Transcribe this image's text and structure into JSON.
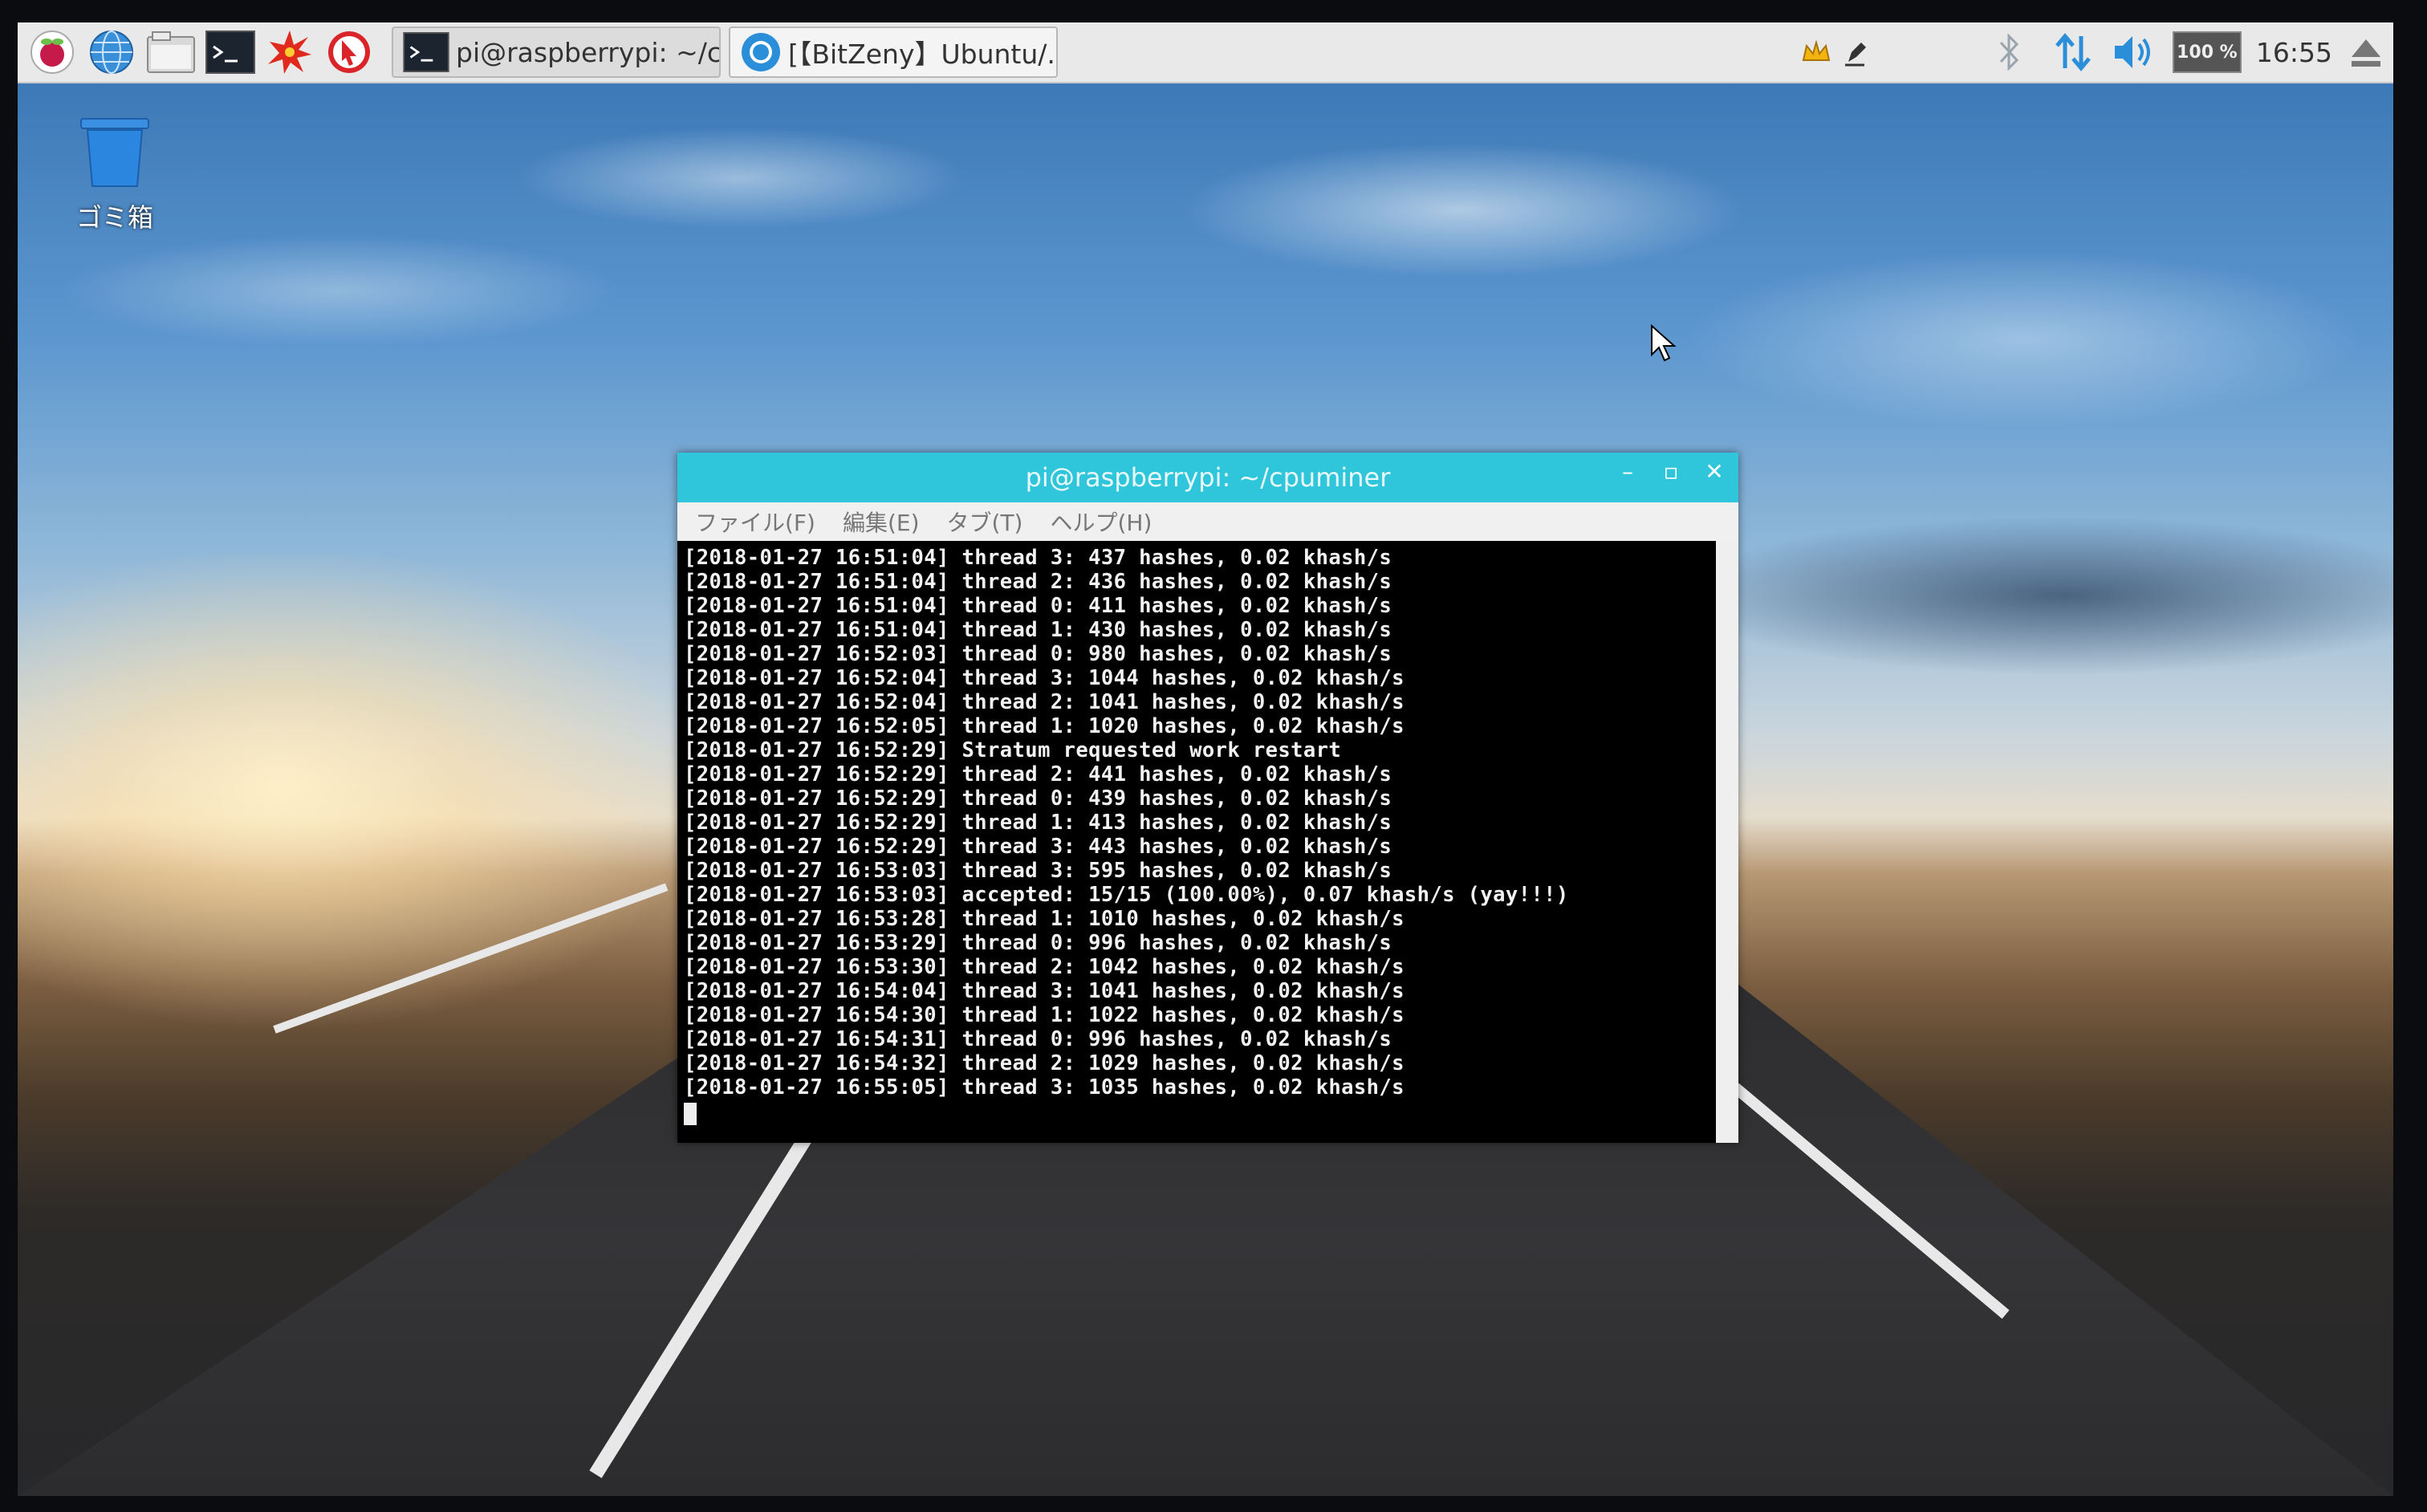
{
  "taskbar": {
    "launchers": [
      "raspberry-menu-icon",
      "globe-icon",
      "folder-icon",
      "terminal-icon",
      "burst-icon",
      "pointer-app-icon"
    ],
    "tasks": [
      {
        "label": "pi@raspberrypi: ~/cp...",
        "icon": "terminal-icon",
        "active": true
      },
      {
        "label": "[【BitZeny】Ubuntu/...",
        "icon": "browser-icon",
        "active": false
      }
    ],
    "tray": {
      "battery": "100 %",
      "clock": "16:55"
    }
  },
  "desktop": {
    "trash_label": "ゴミ箱"
  },
  "terminal": {
    "title": "pi@raspberrypi: ~/cpuminer",
    "menu": [
      "ファイル(F)",
      "編集(E)",
      "タブ(T)",
      "ヘルプ(H)"
    ],
    "lines": [
      "[2018-01-27 16:51:04] thread 3: 437 hashes, 0.02 khash/s",
      "[2018-01-27 16:51:04] thread 2: 436 hashes, 0.02 khash/s",
      "[2018-01-27 16:51:04] thread 0: 411 hashes, 0.02 khash/s",
      "[2018-01-27 16:51:04] thread 1: 430 hashes, 0.02 khash/s",
      "[2018-01-27 16:52:03] thread 0: 980 hashes, 0.02 khash/s",
      "[2018-01-27 16:52:04] thread 3: 1044 hashes, 0.02 khash/s",
      "[2018-01-27 16:52:04] thread 2: 1041 hashes, 0.02 khash/s",
      "[2018-01-27 16:52:05] thread 1: 1020 hashes, 0.02 khash/s",
      "[2018-01-27 16:52:29] Stratum requested work restart",
      "[2018-01-27 16:52:29] thread 2: 441 hashes, 0.02 khash/s",
      "[2018-01-27 16:52:29] thread 0: 439 hashes, 0.02 khash/s",
      "[2018-01-27 16:52:29] thread 1: 413 hashes, 0.02 khash/s",
      "[2018-01-27 16:52:29] thread 3: 443 hashes, 0.02 khash/s",
      "[2018-01-27 16:53:03] thread 3: 595 hashes, 0.02 khash/s",
      "[2018-01-27 16:53:03] accepted: 15/15 (100.00%), 0.07 khash/s (yay!!!)",
      "[2018-01-27 16:53:28] thread 1: 1010 hashes, 0.02 khash/s",
      "[2018-01-27 16:53:29] thread 0: 996 hashes, 0.02 khash/s",
      "[2018-01-27 16:53:30] thread 2: 1042 hashes, 0.02 khash/s",
      "[2018-01-27 16:54:04] thread 3: 1041 hashes, 0.02 khash/s",
      "[2018-01-27 16:54:30] thread 1: 1022 hashes, 0.02 khash/s",
      "[2018-01-27 16:54:31] thread 0: 996 hashes, 0.02 khash/s",
      "[2018-01-27 16:54:32] thread 2: 1029 hashes, 0.02 khash/s",
      "[2018-01-27 16:55:05] thread 3: 1035 hashes, 0.02 khash/s"
    ]
  },
  "colors": {
    "titlebar": "#2fc6dc",
    "terminal_bg": "#000000",
    "terminal_fg": "#f2f2f2",
    "taskbar_bg": "#e9e9e9",
    "tray_icon_blue": "#2a8fd8"
  }
}
